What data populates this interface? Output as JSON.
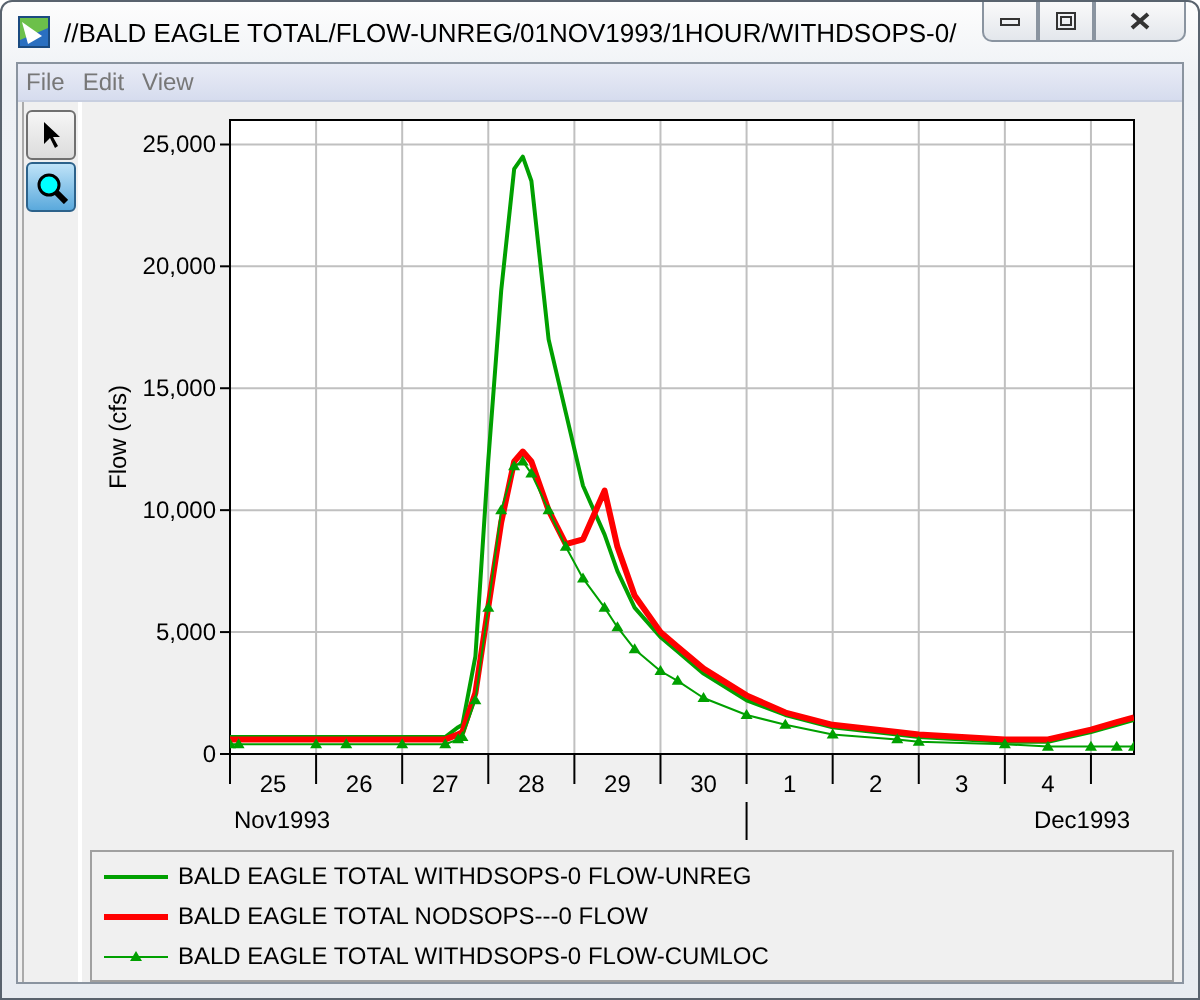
{
  "window": {
    "title": "//BALD EAGLE TOTAL/FLOW-UNREG/01NOV1993/1HOUR/WITHDSOPS-0/"
  },
  "menu": [
    "File",
    "Edit",
    "View"
  ],
  "tools": [
    {
      "kind": "pointer",
      "selected": false
    },
    {
      "kind": "zoom",
      "selected": true
    }
  ],
  "chart": {
    "chart_data": {
      "type": "line",
      "ylabel": "Flow (cfs)",
      "grid": true,
      "x": [
        24.5,
        24.6,
        25.5,
        25.85,
        26.5,
        27,
        27.15,
        27.2,
        27.35,
        27.5,
        27.65,
        27.8,
        27.9,
        28,
        28.2,
        28.4,
        28.6,
        28.85,
        29,
        29.2,
        29.5,
        29.7,
        30,
        30.5,
        30.95,
        31.5,
        32.25,
        32.5,
        33.5,
        34,
        34.5,
        34.8,
        35
      ],
      "xlim": [
        24.5,
        35
      ],
      "ylim": [
        0,
        26000
      ],
      "xticks": [
        25,
        26,
        27,
        28,
        29,
        30
      ],
      "yticks": [
        {
          "value": 0,
          "label": "0"
        },
        {
          "value": 5000,
          "label": "5,000"
        },
        {
          "value": 10000,
          "label": "10,000"
        },
        {
          "value": 15000,
          "label": "15,000"
        },
        {
          "value": 20000,
          "label": "20,000"
        },
        {
          "value": 25000,
          "label": "25,000"
        }
      ],
      "series": [
        {
          "name": "BALD EAGLE TOTAL WITHDSOPS-0 FLOW-UNREG",
          "color": "#00a000",
          "marker": "none",
          "values": [
            700,
            700,
            700,
            700,
            700,
            700,
            1100,
            1200,
            4000,
            12000,
            19000,
            24000,
            24500,
            23500,
            17000,
            14000,
            11000,
            9000,
            7500,
            6000,
            4800,
            4200,
            3300,
            2200,
            1600,
            1100,
            800,
            700,
            500,
            500,
            900,
            1200,
            1400
          ]
        },
        {
          "name": "BALD EAGLE TOTAL NODSOPS---0 FLOW",
          "color": "#ff0000",
          "marker": "none",
          "values": [
            600,
            600,
            600,
            600,
            600,
            600,
            800,
            900,
            2500,
            6000,
            9500,
            12000,
            12400,
            12000,
            10000,
            8600,
            8800,
            10800,
            8500,
            6500,
            5000,
            4400,
            3500,
            2400,
            1700,
            1200,
            900,
            800,
            600,
            600,
            1000,
            1300,
            1500
          ]
        },
        {
          "name": "BALD EAGLE TOTAL WITHDSOPS-0 FLOW-CUMLOC",
          "color": "#00a000",
          "marker": "triangle",
          "values": [
            400,
            400,
            400,
            400,
            400,
            400,
            600,
            700,
            2200,
            6000,
            10000,
            11800,
            12000,
            11500,
            10000,
            8500,
            7200,
            6000,
            5200,
            4300,
            3400,
            3000,
            2300,
            1600,
            1200,
            800,
            600,
            500,
            400,
            300,
            300,
            300,
            300
          ]
        }
      ]
    },
    "next_month_days": [
      "1",
      "2",
      "3",
      "4"
    ],
    "month_axis": [
      {
        "text": "Nov1993"
      },
      {
        "text": "Dec1993"
      }
    ]
  }
}
